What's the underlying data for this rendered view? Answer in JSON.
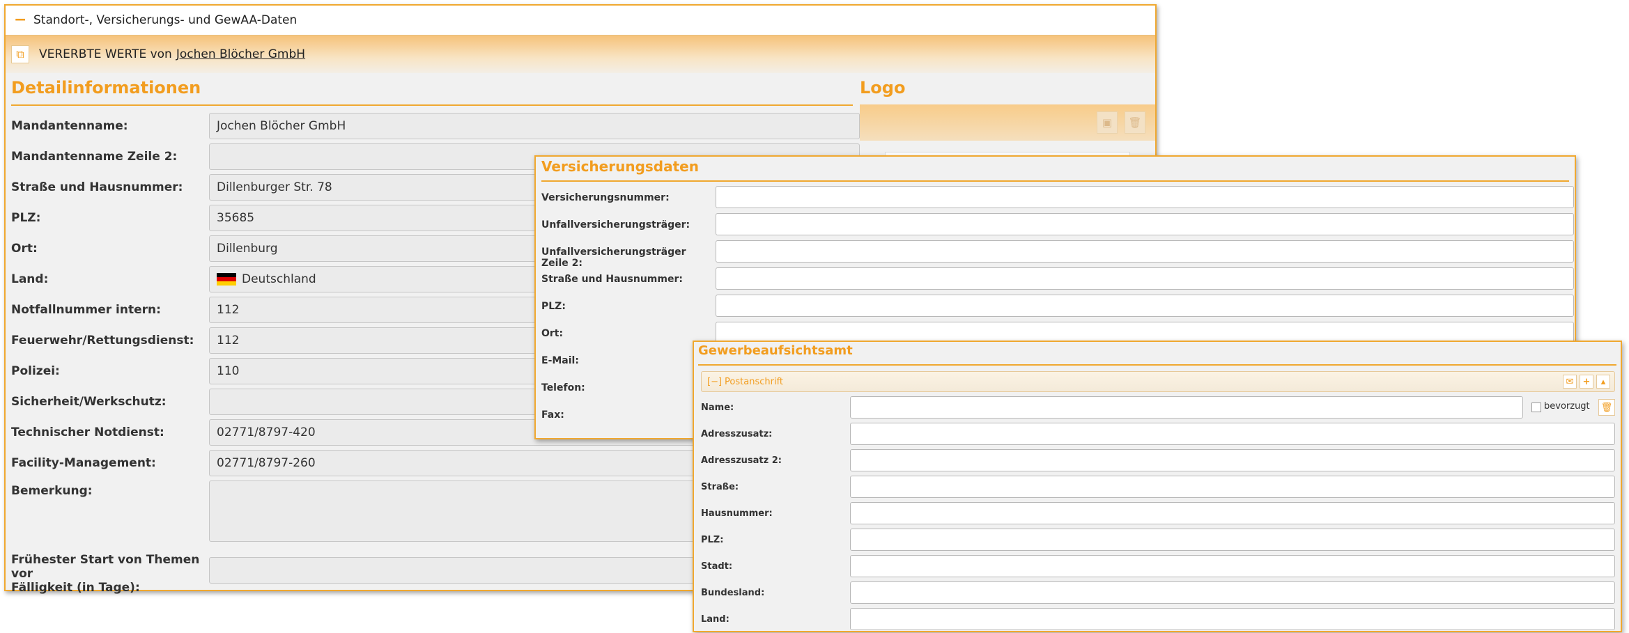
{
  "main": {
    "header_title": "Standort-, Versicherungs- und GewAA-Daten",
    "collapse_symbol": "−",
    "inherit_text": "VERERBTE WERTE von",
    "inherit_link": "Jochen Blöcher GmbH",
    "detail_title": "Detailinformationen",
    "logo_title": "Logo",
    "fields": [
      {
        "label": "Mandantenname:",
        "value": "Jochen Blöcher GmbH"
      },
      {
        "label": "Mandantenname Zeile 2:",
        "value": ""
      },
      {
        "label": "Straße und Hausnummer:",
        "value": "Dillenburger Str. 78"
      },
      {
        "label": "PLZ:",
        "value": "35685"
      },
      {
        "label": "Ort:",
        "value": "Dillenburg"
      },
      {
        "label": "Land:",
        "value": "Deutschland"
      },
      {
        "label": "Notfallnummer intern:",
        "value": "112"
      },
      {
        "label": "Feuerwehr/Rettungsdienst:",
        "value": "112"
      },
      {
        "label": "Polizei:",
        "value": "110"
      },
      {
        "label": "Sicherheit/Werkschutz:",
        "value": ""
      },
      {
        "label": "Technischer Notdienst:",
        "value": "02771/8797-420"
      },
      {
        "label": "Facility-Management:",
        "value": "02771/8797-260"
      },
      {
        "label": "Bemerkung:",
        "value": ""
      }
    ],
    "start_label_line1": "Frühester Start von Themen vor",
    "start_label_line2": "Fälligkeit (in Tage):",
    "start_value": ""
  },
  "versicherung": {
    "title": "Versicherungsdaten",
    "fields": [
      {
        "label": "Versicherungsnummer:"
      },
      {
        "label": "Unfallversicherungsträger:"
      },
      {
        "label": "Unfallversicherungsträger Zeile 2:"
      },
      {
        "label": "Straße und Hausnummer:"
      },
      {
        "label": "PLZ:"
      },
      {
        "label": "Ort:"
      },
      {
        "label": "E-Mail:"
      },
      {
        "label": "Telefon:"
      },
      {
        "label": "Fax:"
      }
    ]
  },
  "gewerbe": {
    "title": "Gewerbeaufsichtsamt",
    "postanschrift_toggle": "[−]",
    "postanschrift_label": "Postanschrift",
    "bevorzugt_label": "bevorzugt",
    "fields": [
      {
        "label": "Name:"
      },
      {
        "label": "Adresszusatz:"
      },
      {
        "label": "Adresszusatz 2:"
      },
      {
        "label": "Straße:"
      },
      {
        "label": "Hausnummer:"
      },
      {
        "label": "PLZ:"
      },
      {
        "label": "Stadt:"
      },
      {
        "label": "Bundesland:"
      },
      {
        "label": "Land:"
      }
    ]
  },
  "colors": {
    "accent": "#f29d1f",
    "panel_bg": "#f1f1f1",
    "border": "#f0a830"
  },
  "icons": [
    "minus-icon",
    "inherit-icon",
    "image-icon",
    "trash-icon",
    "envelope-icon",
    "plus-icon",
    "caret-up-icon",
    "flag-de-icon"
  ]
}
